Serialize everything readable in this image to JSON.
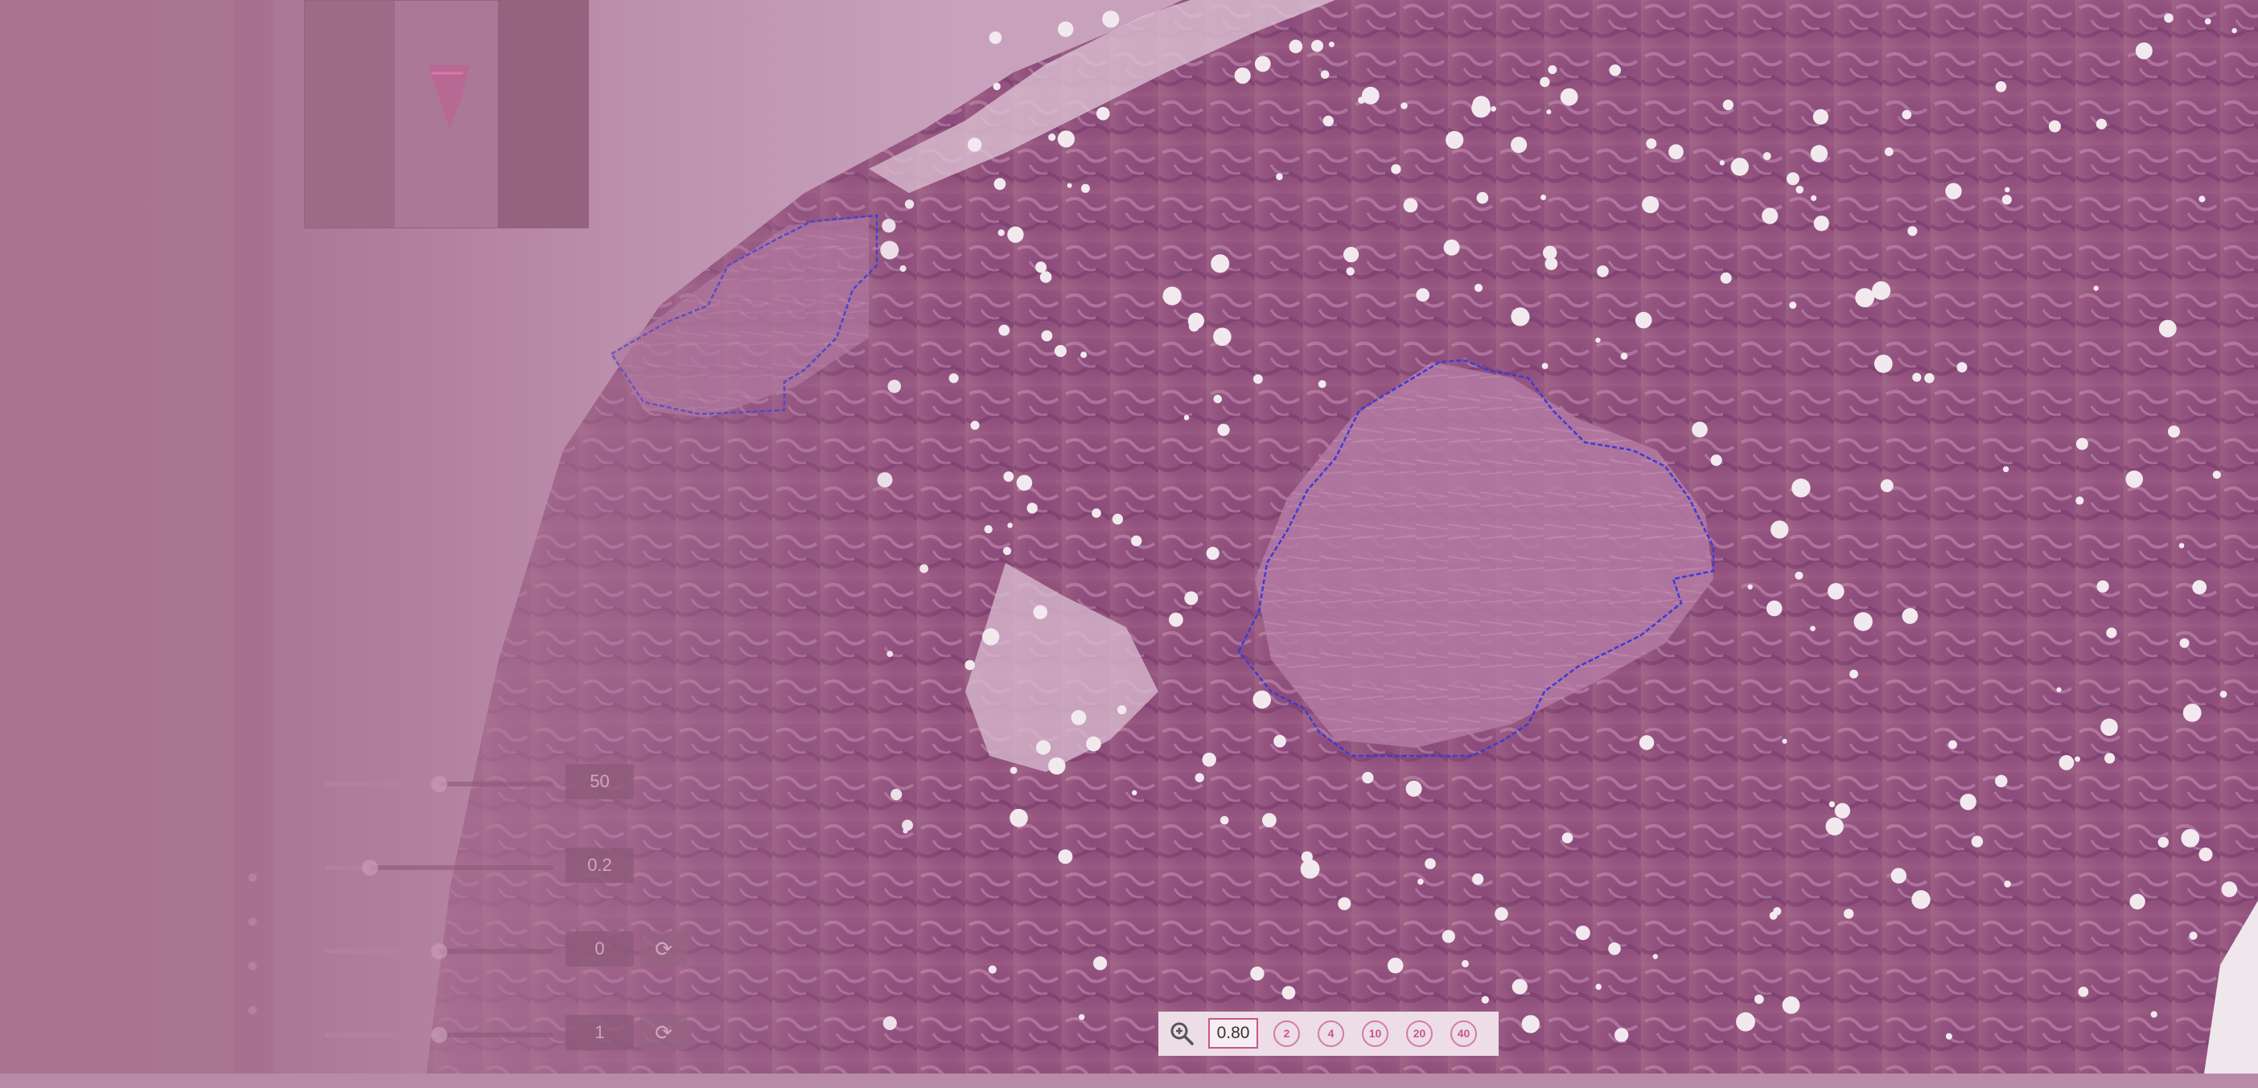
{
  "adjustments": [
    {
      "value": "50",
      "fill": 0.5,
      "has_reset": false
    },
    {
      "value": "0.2",
      "fill": 0.2,
      "has_reset": false
    },
    {
      "value": "0",
      "fill": 0.5,
      "has_reset": true
    },
    {
      "value": "1",
      "fill": 0.5,
      "has_reset": true
    }
  ],
  "zoom": {
    "current": "0.80",
    "presets": [
      "2",
      "4",
      "10",
      "20",
      "40"
    ]
  },
  "icons": {
    "zoom": "zoom-in-icon",
    "reset": "refresh-icon"
  },
  "colors": {
    "accent": "#c8568e",
    "annotation": "#3b3bd6",
    "tissue_dark": "#7a3f6c",
    "tissue_light": "#c892b6"
  }
}
